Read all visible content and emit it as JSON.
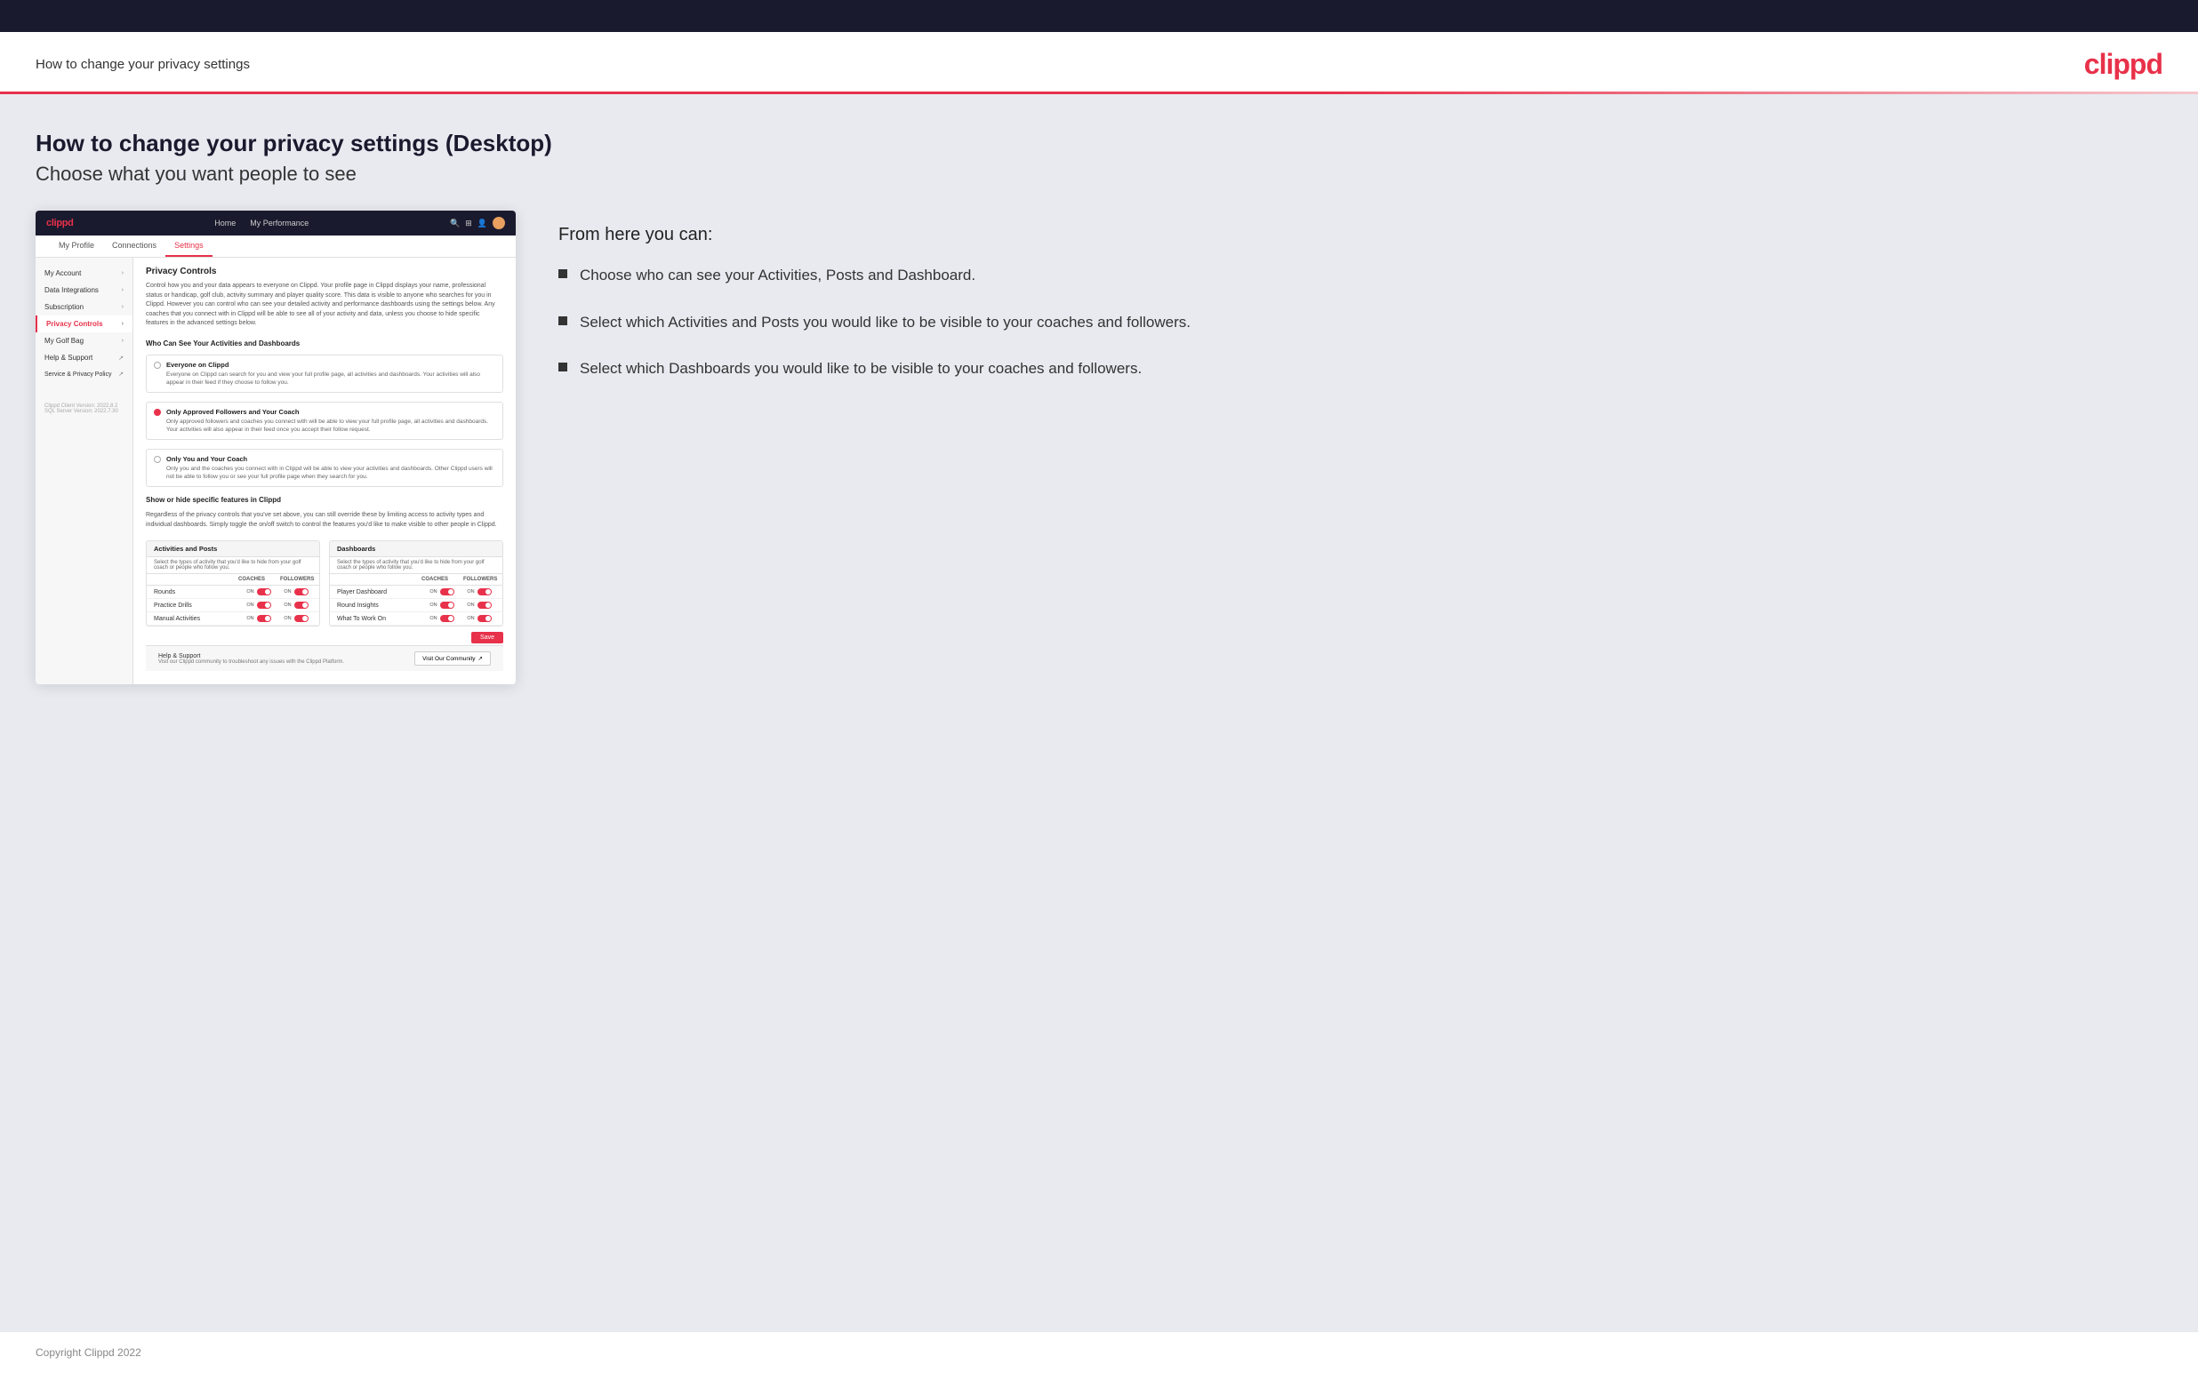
{
  "header": {
    "title": "How to change your privacy settings",
    "logo": "clippd"
  },
  "main": {
    "title": "How to change your privacy settings (Desktop)",
    "subtitle": "Choose what you want people to see",
    "info_heading": "From here you can:",
    "bullets": [
      "Choose who can see your Activities, Posts and Dashboard.",
      "Select which Activities and Posts you would like to be visible to your coaches and followers.",
      "Select which Dashboards you would like to be visible to your coaches and followers."
    ]
  },
  "app_mockup": {
    "nav": {
      "logo": "clippd",
      "links": [
        "Home",
        "My Performance"
      ],
      "icons": [
        "search",
        "grid",
        "user",
        "avatar"
      ]
    },
    "sub_nav": [
      {
        "label": "My Profile",
        "active": false
      },
      {
        "label": "Connections",
        "active": false
      },
      {
        "label": "Settings",
        "active": true
      }
    ],
    "sidebar": [
      {
        "label": "My Account",
        "active": false
      },
      {
        "label": "Data Integrations",
        "active": false
      },
      {
        "label": "Subscription",
        "active": false
      },
      {
        "label": "Privacy Controls",
        "active": true
      },
      {
        "label": "My Golf Bag",
        "active": false
      },
      {
        "label": "Help & Support",
        "active": false
      },
      {
        "label": "Service & Privacy Policy",
        "active": false
      }
    ],
    "sidebar_version": "Clippd Client Version: 2022.8.2\nSQL Server Version: 2022.7.30",
    "privacy_controls": {
      "section_title": "Privacy Controls",
      "section_desc": "Control how you and your data appears to everyone on Clippd. Your profile page in Clippd displays your name, professional status or handicap, golf club, activity summary and player quality score. This data is visible to anyone who searches for you in Clippd. However you can control who can see your detailed activity and performance dashboards using the settings below. Any coaches that you connect with in Clippd will be able to see all of your activity and data, unless you choose to hide specific features in the advanced settings below.",
      "who_can_see_title": "Who Can See Your Activities and Dashboards",
      "radio_options": [
        {
          "label": "Everyone on Clippd",
          "desc": "Everyone on Clippd can search for you and view your full profile page, all activities and dashboards. Your activities will also appear in their feed if they choose to follow you.",
          "selected": false
        },
        {
          "label": "Only Approved Followers and Your Coach",
          "desc": "Only approved followers and coaches you connect with will be able to view your full profile page, all activities and dashboards. Your activities will also appear in their feed once you accept their follow request.",
          "selected": true
        },
        {
          "label": "Only You and Your Coach",
          "desc": "Only you and the coaches you connect with in Clippd will be able to view your activities and dashboards. Other Clippd users will not be able to follow you or see your full profile page when they search for you.",
          "selected": false
        }
      ],
      "show_hide_title": "Show or hide specific features in Clippd",
      "show_hide_desc": "Regardless of the privacy controls that you've set above, you can still override these by limiting access to activity types and individual dashboards. Simply toggle the on/off switch to control the features you'd like to make visible to other people in Clippd.",
      "activities_posts": {
        "title": "Activities and Posts",
        "desc": "Select the types of activity that you'd like to hide from your golf coach or people who follow you.",
        "col_coaches": "COACHES",
        "col_followers": "FOLLOWERS",
        "rows": [
          {
            "label": "Rounds",
            "coaches_on": true,
            "followers_on": true
          },
          {
            "label": "Practice Drills",
            "coaches_on": true,
            "followers_on": true
          },
          {
            "label": "Manual Activities",
            "coaches_on": true,
            "followers_on": true
          }
        ]
      },
      "dashboards": {
        "title": "Dashboards",
        "desc": "Select the types of activity that you'd like to hide from your golf coach or people who follow you.",
        "col_coaches": "COACHES",
        "col_followers": "FOLLOWERS",
        "rows": [
          {
            "label": "Player Dashboard",
            "coaches_on": true,
            "followers_on": true
          },
          {
            "label": "Round Insights",
            "coaches_on": true,
            "followers_on": true
          },
          {
            "label": "What To Work On",
            "coaches_on": true,
            "followers_on": true
          }
        ]
      },
      "save_label": "Save"
    },
    "help": {
      "title": "Help & Support",
      "desc": "Visit our Clippd community to troubleshoot any issues with the Clippd Platform.",
      "button": "Visit Our Community"
    }
  },
  "footer": {
    "copyright": "Copyright Clippd 2022"
  }
}
